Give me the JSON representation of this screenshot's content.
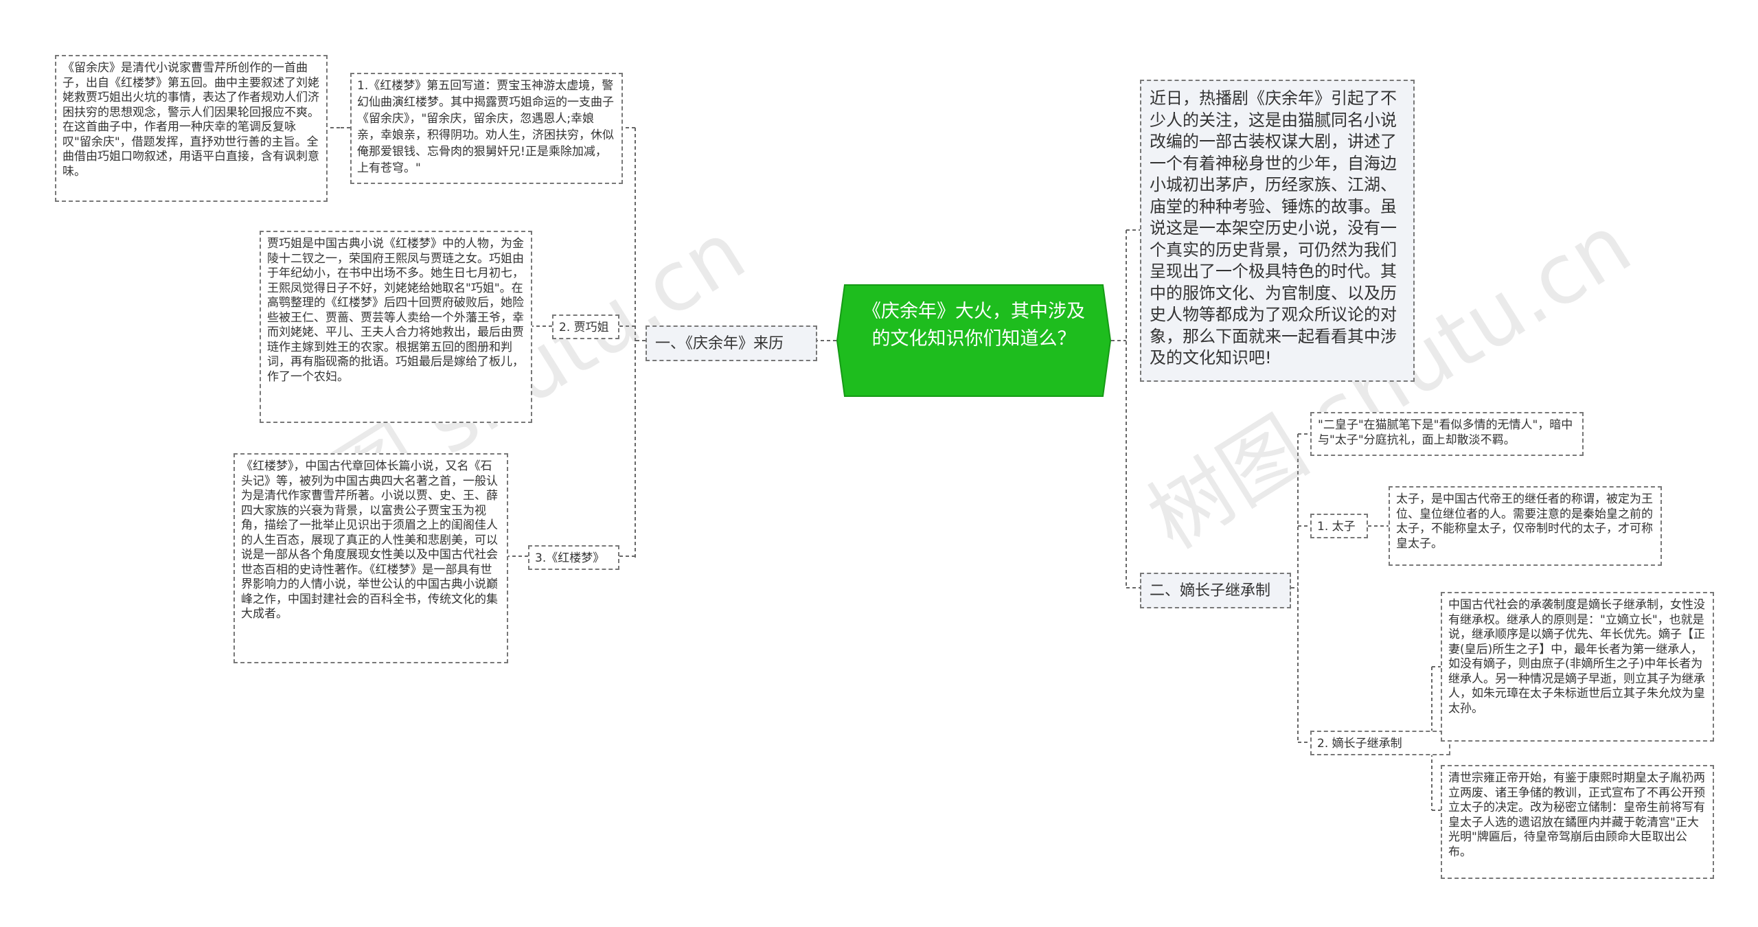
{
  "center": {
    "title": "《庆余年》大火，其中涉及的文化知识你们知道么？"
  },
  "left": {
    "branch_label": "一、《庆余年》来历",
    "sub1": {
      "label": "1.《红楼梦》第五回写道：贾宝玉神游太虚境，警幻仙曲演红楼梦。其中揭露贾巧姐命运的一支曲子《留余庆》，\"留余庆，留余庆，忽遇恩人;幸娘亲，幸娘亲，积得阴功。劝人生，济困扶穷，休似俺那爱银钱、忘骨肉的狠舅奸兄!正是乘除加减，上有苍穹。\"",
      "detail": "《留余庆》是清代小说家曹雪芹所创作的一首曲子，出自《红楼梦》第五回。曲中主要叙述了刘姥姥救贾巧姐出火坑的事情，表达了作者规劝人们济困扶穷的思想观念，警示人们因果轮回报应不爽。在这首曲子中，作者用一种庆幸的笔调反复咏叹\"留余庆\"，借题发挥，直抒劝世行善的主旨。全曲借由巧姐口吻叙述，用语平白直接，含有讽刺意味。"
    },
    "sub2": {
      "label": "2. 贾巧姐",
      "detail": "贾巧姐是中国古典小说《红楼梦》中的人物，为金陵十二钗之一，荣国府王熙凤与贾琏之女。巧姐由于年纪幼小，在书中出场不多。她生日七月初七，王熙凤觉得日子不好，刘姥姥给她取名\"巧姐\"。在高鹗整理的《红楼梦》后四十回贾府破败后，她险些被王仁、贾蔷、贾芸等人卖给一个外藩王爷，幸而刘姥姥、平儿、王夫人合力将她救出，最后由贾琏作主嫁到姓王的农家。根据第五回的图册和判词，再有脂砚斋的批语。巧姐最后是嫁给了板儿，作了一个农妇。"
    },
    "sub3": {
      "label": "3.《红楼梦》",
      "detail": "《红楼梦》，中国古代章回体长篇小说，又名《石头记》等，被列为中国古典四大名著之首，一般认为是清代作家曹雪芹所著。小说以贾、史、王、薛四大家族的兴衰为背景，以富贵公子贾宝玉为视角，描绘了一批举止见识出于须眉之上的闺阁佳人的人生百态，展现了真正的人性美和悲剧美，可以说是一部从各个角度展现女性美以及中国古代社会世态百相的史诗性著作。《红楼梦》是一部具有世界影响力的人情小说，举世公认的中国古典小说巅峰之作，中国封建社会的百科全书，传统文化的集大成者。"
    }
  },
  "right": {
    "intro": "近日，热播剧《庆余年》引起了不少人的关注，这是由猫腻同名小说改编的一部古装权谋大剧，讲述了一个有着神秘身世的少年，自海边小城初出茅庐，历经家族、江湖、庙堂的种种考验、锤炼的故事。虽说这是一本架空历史小说，没有一个真实的历史背景，可仍然为我们呈现出了一个极具特色的时代。其中的服饰文化、为官制度、以及历史人物等都成为了观众所议论的对象，那么下面就来一起看看其中涉及的文化知识吧!",
    "branch_label": "二、嫡长子继承制",
    "note": "\"二皇子\"在猫腻笔下是\"看似多情的无情人\"，暗中与\"太子\"分庭抗礼，面上却散淡不羁。",
    "sub1": {
      "label": "1. 太子",
      "detail": "太子，是中国古代帝王的继任者的称谓，被定为王位、皇位继位者的人。需要注意的是秦始皇之前的太子，不能称皇太子，仅帝制时代的太子，才可称皇太子。"
    },
    "sub2": {
      "label": "2. 嫡长子继承制",
      "detail1": "中国古代社会的承袭制度是嫡长子继承制，女性没有继承权。继承人的原则是：\"立嫡立长\"，也就是说，继承顺序是以嫡子优先、年长优先。嫡子【正妻(皇后)所生之子】中，最年长者为第一继承人，如没有嫡子，则由庶子(非嫡所生之子)中年长者为继承人。另一种情况是嫡子早逝，则立其子为继承人，如朱元璋在太子朱标逝世后立其子朱允炆为皇太孙。",
      "detail2": "清世宗雍正帝开始，有鉴于康熙时期皇太子胤礽两立两废、诸王争储的教训，正式宣布了不再公开预立太子的决定。改为秘密立储制：皇帝生前将写有皇太子人选的遗诏放在鐍匣内并藏于乾清宫\"正大光明\"牌匾后，待皇帝驾崩后由顾命大臣取出公布。"
    }
  },
  "watermarks": [
    "树图 shutu.cn",
    "树图 shutu.cn"
  ],
  "colors": {
    "center_fill": "#1ebd1e",
    "center_border": "#159a15",
    "line": "#666666",
    "branch_bg": "#f1f3f7"
  }
}
